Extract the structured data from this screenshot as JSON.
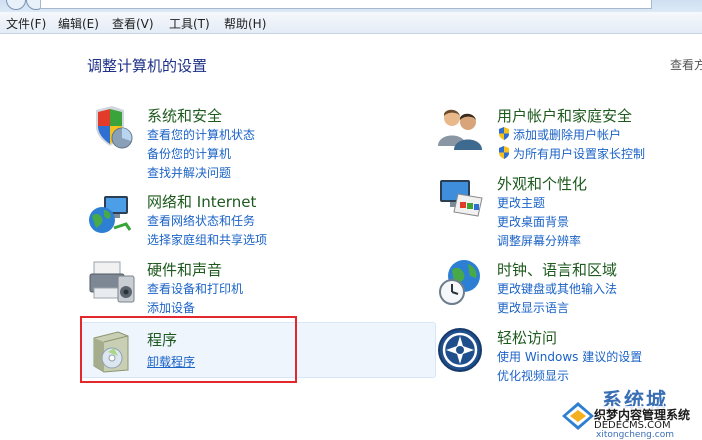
{
  "menu": [
    {
      "label": "文件(F)"
    },
    {
      "label": "编辑(E)"
    },
    {
      "label": "查看(V)"
    },
    {
      "label": "工具(T)"
    },
    {
      "label": "帮助(H)"
    }
  ],
  "page_title": "调整计算机的设置",
  "view_by": "查看方",
  "categories": {
    "system": {
      "title": "系统和安全",
      "links": [
        "查看您的计算机状态",
        "备份您的计算机",
        "查找并解决问题"
      ],
      "icon": "shield-computer-icon"
    },
    "network": {
      "title": "网络和 Internet",
      "links": [
        "查看网络状态和任务",
        "选择家庭组和共享选项"
      ],
      "icon": "network-globe-icon"
    },
    "hardware": {
      "title": "硬件和声音",
      "links": [
        "查看设备和打印机",
        "添加设备"
      ],
      "icon": "printer-icon"
    },
    "programs": {
      "title": "程序",
      "links": [
        "卸载程序"
      ],
      "icon": "programs-box-icon"
    },
    "users": {
      "title": "用户帐户和家庭安全",
      "links": [
        "添加或删除用户帐户",
        "为所有用户设置家长控制"
      ],
      "icon": "users-icon"
    },
    "appearance": {
      "title": "外观和个性化",
      "links": [
        "更改主题",
        "更改桌面背景",
        "调整屏幕分辨率"
      ],
      "icon": "monitor-paint-icon"
    },
    "clock": {
      "title": "时钟、语言和区域",
      "links": [
        "更改键盘或其他输入法",
        "更改显示语言"
      ],
      "icon": "clock-globe-icon"
    },
    "ease": {
      "title": "轻松访问",
      "links": [
        "使用 Windows 建议的设置",
        "优化视频显示"
      ],
      "icon": "ease-of-access-icon"
    }
  },
  "watermark": {
    "title": "系统城",
    "sub": "织梦内容管理系统",
    "url": "DEDECMS.COM",
    "url2": "xitongcheng.com"
  }
}
